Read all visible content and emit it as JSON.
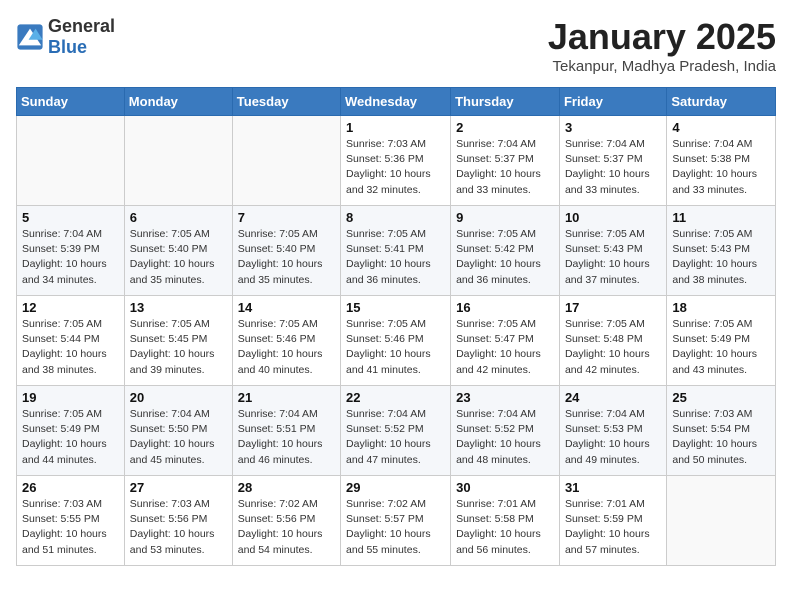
{
  "header": {
    "logo_general": "General",
    "logo_blue": "Blue",
    "month_title": "January 2025",
    "location": "Tekanpur, Madhya Pradesh, India"
  },
  "weekdays": [
    "Sunday",
    "Monday",
    "Tuesday",
    "Wednesday",
    "Thursday",
    "Friday",
    "Saturday"
  ],
  "weeks": [
    [
      {
        "day": "",
        "info": ""
      },
      {
        "day": "",
        "info": ""
      },
      {
        "day": "",
        "info": ""
      },
      {
        "day": "1",
        "info": "Sunrise: 7:03 AM\nSunset: 5:36 PM\nDaylight: 10 hours\nand 32 minutes."
      },
      {
        "day": "2",
        "info": "Sunrise: 7:04 AM\nSunset: 5:37 PM\nDaylight: 10 hours\nand 33 minutes."
      },
      {
        "day": "3",
        "info": "Sunrise: 7:04 AM\nSunset: 5:37 PM\nDaylight: 10 hours\nand 33 minutes."
      },
      {
        "day": "4",
        "info": "Sunrise: 7:04 AM\nSunset: 5:38 PM\nDaylight: 10 hours\nand 33 minutes."
      }
    ],
    [
      {
        "day": "5",
        "info": "Sunrise: 7:04 AM\nSunset: 5:39 PM\nDaylight: 10 hours\nand 34 minutes."
      },
      {
        "day": "6",
        "info": "Sunrise: 7:05 AM\nSunset: 5:40 PM\nDaylight: 10 hours\nand 35 minutes."
      },
      {
        "day": "7",
        "info": "Sunrise: 7:05 AM\nSunset: 5:40 PM\nDaylight: 10 hours\nand 35 minutes."
      },
      {
        "day": "8",
        "info": "Sunrise: 7:05 AM\nSunset: 5:41 PM\nDaylight: 10 hours\nand 36 minutes."
      },
      {
        "day": "9",
        "info": "Sunrise: 7:05 AM\nSunset: 5:42 PM\nDaylight: 10 hours\nand 36 minutes."
      },
      {
        "day": "10",
        "info": "Sunrise: 7:05 AM\nSunset: 5:43 PM\nDaylight: 10 hours\nand 37 minutes."
      },
      {
        "day": "11",
        "info": "Sunrise: 7:05 AM\nSunset: 5:43 PM\nDaylight: 10 hours\nand 38 minutes."
      }
    ],
    [
      {
        "day": "12",
        "info": "Sunrise: 7:05 AM\nSunset: 5:44 PM\nDaylight: 10 hours\nand 38 minutes."
      },
      {
        "day": "13",
        "info": "Sunrise: 7:05 AM\nSunset: 5:45 PM\nDaylight: 10 hours\nand 39 minutes."
      },
      {
        "day": "14",
        "info": "Sunrise: 7:05 AM\nSunset: 5:46 PM\nDaylight: 10 hours\nand 40 minutes."
      },
      {
        "day": "15",
        "info": "Sunrise: 7:05 AM\nSunset: 5:46 PM\nDaylight: 10 hours\nand 41 minutes."
      },
      {
        "day": "16",
        "info": "Sunrise: 7:05 AM\nSunset: 5:47 PM\nDaylight: 10 hours\nand 42 minutes."
      },
      {
        "day": "17",
        "info": "Sunrise: 7:05 AM\nSunset: 5:48 PM\nDaylight: 10 hours\nand 42 minutes."
      },
      {
        "day": "18",
        "info": "Sunrise: 7:05 AM\nSunset: 5:49 PM\nDaylight: 10 hours\nand 43 minutes."
      }
    ],
    [
      {
        "day": "19",
        "info": "Sunrise: 7:05 AM\nSunset: 5:49 PM\nDaylight: 10 hours\nand 44 minutes."
      },
      {
        "day": "20",
        "info": "Sunrise: 7:04 AM\nSunset: 5:50 PM\nDaylight: 10 hours\nand 45 minutes."
      },
      {
        "day": "21",
        "info": "Sunrise: 7:04 AM\nSunset: 5:51 PM\nDaylight: 10 hours\nand 46 minutes."
      },
      {
        "day": "22",
        "info": "Sunrise: 7:04 AM\nSunset: 5:52 PM\nDaylight: 10 hours\nand 47 minutes."
      },
      {
        "day": "23",
        "info": "Sunrise: 7:04 AM\nSunset: 5:52 PM\nDaylight: 10 hours\nand 48 minutes."
      },
      {
        "day": "24",
        "info": "Sunrise: 7:04 AM\nSunset: 5:53 PM\nDaylight: 10 hours\nand 49 minutes."
      },
      {
        "day": "25",
        "info": "Sunrise: 7:03 AM\nSunset: 5:54 PM\nDaylight: 10 hours\nand 50 minutes."
      }
    ],
    [
      {
        "day": "26",
        "info": "Sunrise: 7:03 AM\nSunset: 5:55 PM\nDaylight: 10 hours\nand 51 minutes."
      },
      {
        "day": "27",
        "info": "Sunrise: 7:03 AM\nSunset: 5:56 PM\nDaylight: 10 hours\nand 53 minutes."
      },
      {
        "day": "28",
        "info": "Sunrise: 7:02 AM\nSunset: 5:56 PM\nDaylight: 10 hours\nand 54 minutes."
      },
      {
        "day": "29",
        "info": "Sunrise: 7:02 AM\nSunset: 5:57 PM\nDaylight: 10 hours\nand 55 minutes."
      },
      {
        "day": "30",
        "info": "Sunrise: 7:01 AM\nSunset: 5:58 PM\nDaylight: 10 hours\nand 56 minutes."
      },
      {
        "day": "31",
        "info": "Sunrise: 7:01 AM\nSunset: 5:59 PM\nDaylight: 10 hours\nand 57 minutes."
      },
      {
        "day": "",
        "info": ""
      }
    ]
  ]
}
